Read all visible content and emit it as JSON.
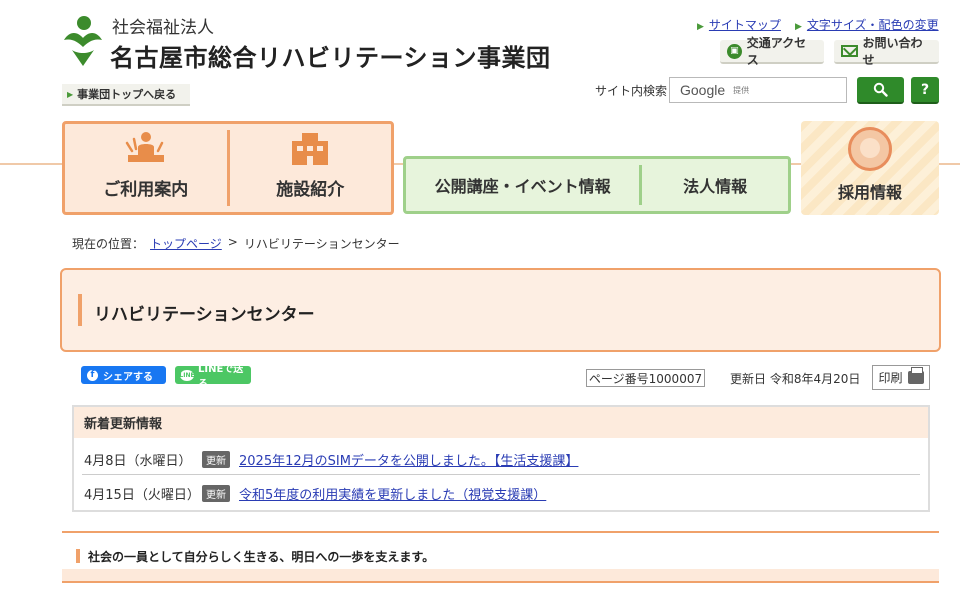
{
  "header": {
    "org_type": "社会福祉法人",
    "org_name": "名古屋市総合リハビリテーション事業団",
    "back_to_top": "事業団トップへ戻る"
  },
  "utility": {
    "sitemap": "サイトマップ",
    "text_size": "文字サイズ・配色の変更",
    "access": "交通アクセス",
    "contact": "お問い合わせ"
  },
  "search": {
    "label": "サイト内検索",
    "google": "Google",
    "provided": "提供",
    "help": "?"
  },
  "nav": {
    "usage": "ご利用案内",
    "facilities": "施設紹介",
    "events": "公開講座・イベント情報",
    "corporate": "法人情報",
    "recruit": "採用情報"
  },
  "breadcrumb": {
    "label": "現在の位置：",
    "home": "トップページ",
    "separator": ">",
    "current": "リハビリテーションセンター"
  },
  "page": {
    "title": "リハビリテーションセンター",
    "page_number": "ページ番号1000007",
    "updated": "更新日 令和8年4月20日",
    "print": "印刷"
  },
  "share": {
    "facebook": "シェアする",
    "line": "LINEで送る",
    "line_icon": "LINE"
  },
  "news": {
    "heading": "新着更新情報",
    "items": [
      {
        "date": "4月8日（水曜日）",
        "tag": "更新",
        "text": "2025年12月のSIMデータを公開しました。【生活支援課】"
      },
      {
        "date": "4月15日（火曜日）",
        "tag": "更新",
        "text": "令和5年度の利用実績を更新しました（視覚支援課）"
      }
    ]
  },
  "tagline": "社会の一員として自分らしく生きる、明日への一歩を支えます。",
  "colors": {
    "accent_orange": "#f0a16a",
    "accent_green": "#2f8a2a",
    "link_blue": "#2a3cb4"
  }
}
